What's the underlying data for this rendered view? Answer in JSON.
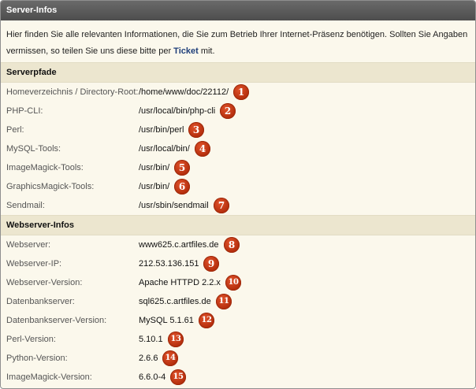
{
  "title": "Server-Infos",
  "intro": {
    "text_before": "Hier finden Sie alle relevanten Informationen, die Sie zum Betrieb Ihrer Internet-Präsenz benötigen. Sollten Sie Angaben vermissen, so teilen Sie uns diese bitte per ",
    "link": "Ticket",
    "text_after": " mit."
  },
  "serverpfade": {
    "heading": "Serverpfade",
    "rows": [
      {
        "label": "Homeverzeichnis / Directory-Root:",
        "value": "/home/www/doc/22112/",
        "badge": "1"
      },
      {
        "label": "PHP-CLI:",
        "value": "/usr/local/bin/php-cli",
        "badge": "2"
      },
      {
        "label": "Perl:",
        "value": "/usr/bin/perl",
        "badge": "3"
      },
      {
        "label": "MySQL-Tools:",
        "value": "/usr/local/bin/",
        "badge": "4"
      },
      {
        "label": "ImageMagick-Tools:",
        "value": "/usr/bin/",
        "badge": "5"
      },
      {
        "label": "GraphicsMagick-Tools:",
        "value": "/usr/bin/",
        "badge": "6"
      },
      {
        "label": "Sendmail:",
        "value": "/usr/sbin/sendmail",
        "badge": "7"
      }
    ]
  },
  "webserver": {
    "heading": "Webserver-Infos",
    "rows": [
      {
        "label": "Webserver:",
        "value": "www625.c.artfiles.de",
        "badge": "8"
      },
      {
        "label": "Webserver-IP:",
        "value": "212.53.136.151",
        "badge": "9"
      },
      {
        "label": "Webserver-Version:",
        "value": "Apache HTTPD 2.2.x",
        "badge": "10"
      },
      {
        "label": "Datenbankserver:",
        "value": "sql625.c.artfiles.de",
        "badge": "11"
      },
      {
        "label": "Datenbankserver-Version:",
        "value": "MySQL 5.1.61",
        "badge": "12"
      },
      {
        "label": "Perl-Version:",
        "value": "5.10.1",
        "badge": "13"
      },
      {
        "label": "Python-Version:",
        "value": "2.6.6",
        "badge": "14"
      },
      {
        "label": "ImageMagick-Version:",
        "value": "6.6.0-4",
        "badge": "15"
      }
    ]
  },
  "colors": {
    "titlebar": "#4d4d4d",
    "panel_bg": "#fbf8ec",
    "section_bg": "#ece6cf",
    "badge": "#c8401a",
    "link": "#1f3f7a"
  }
}
